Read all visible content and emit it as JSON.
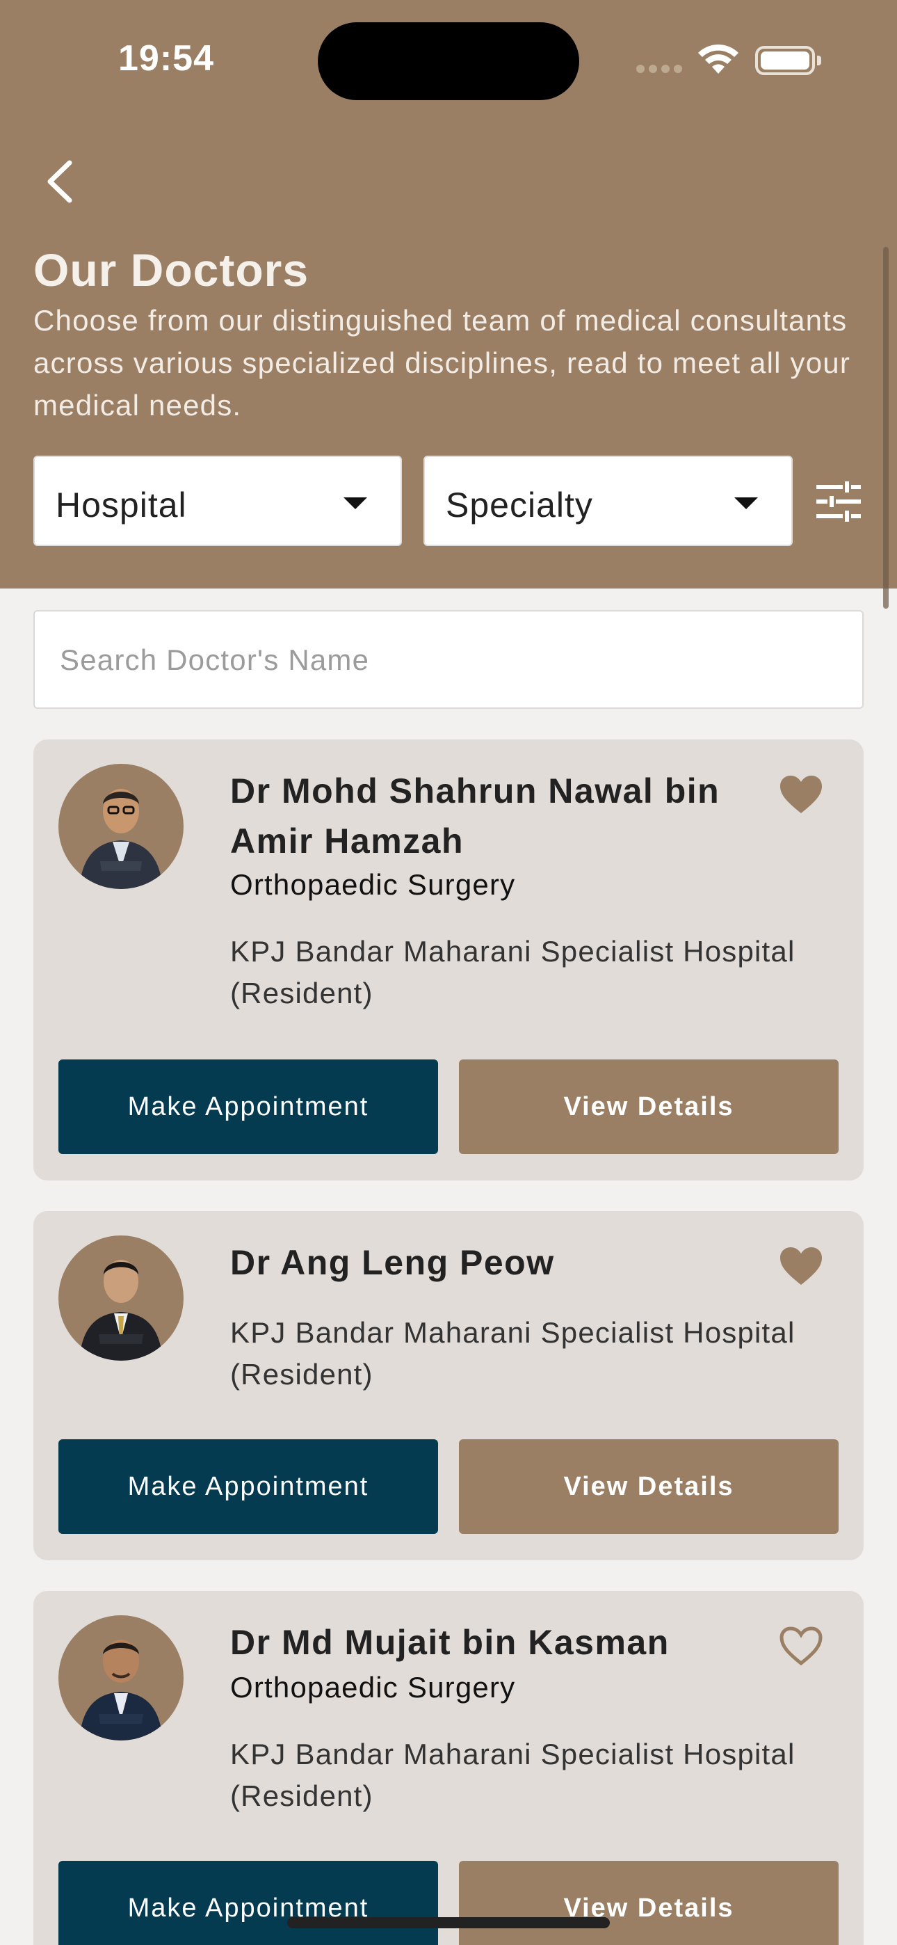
{
  "status_bar": {
    "time": "19:54"
  },
  "header": {
    "title": "Our Doctors",
    "description": "Choose from our distinguished team of medical consultants across various specialized disciplines, read to meet all your medical needs.",
    "filters": {
      "hospital_label": "Hospital",
      "specialty_label": "Specialty"
    }
  },
  "search": {
    "placeholder": "Search Doctor's Name"
  },
  "doctors": [
    {
      "name": "Dr Mohd Shahrun Nawal bin Amir Hamzah",
      "specialty": "Orthopaedic Surgery",
      "hospital": "KPJ Bandar Maharani Specialist Hospital (Resident)",
      "favorite": true
    },
    {
      "name": "Dr Ang Leng Peow",
      "specialty": "",
      "hospital": "KPJ Bandar Maharani Specialist Hospital (Resident)",
      "favorite": true
    },
    {
      "name": "Dr Md Mujait bin Kasman",
      "specialty": "Orthopaedic Surgery",
      "hospital": "KPJ Bandar Maharani Specialist Hospital (Resident)",
      "favorite": false
    }
  ],
  "buttons": {
    "appointment": "Make Appointment",
    "details": "View Details"
  },
  "colors": {
    "header": "#9a7f64",
    "primary_button": "#053b51",
    "secondary_button": "#9a7f64",
    "card": "#e2dcd8"
  }
}
